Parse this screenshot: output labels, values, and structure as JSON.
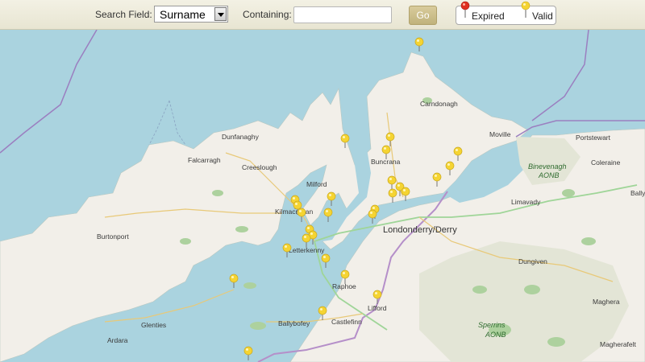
{
  "toolbar": {
    "search_field_label": "Search Field:",
    "search_field_value": "Surname",
    "containing_label": "Containing:",
    "containing_value": "",
    "go_label": "Go",
    "legend_expired": "Expired",
    "legend_valid": "Valid"
  },
  "colors": {
    "sea": "#aad3df",
    "land": "#f2efe9",
    "expired_pin": "#e03020",
    "valid_pin": "#f5d432"
  },
  "map": {
    "places": [
      "Dunfanaghy",
      "Falcarragh",
      "Creeslough",
      "Milford",
      "Buncrana",
      "Carndonagh",
      "Moville",
      "Portstewart",
      "Coleraine",
      "Binevenagh",
      "AONB",
      "Limavady",
      "Bally",
      "Kilmacrenan",
      "Letterkenny",
      "Londonderry/Derry",
      "Burtonport",
      "Raphoe",
      "Dungiven",
      "Lifford",
      "Ballybofey",
      "Castlefinn",
      "Glenties",
      "Ardara",
      "Sperrins",
      "AONB",
      "Maghera",
      "Magherafelt"
    ]
  }
}
